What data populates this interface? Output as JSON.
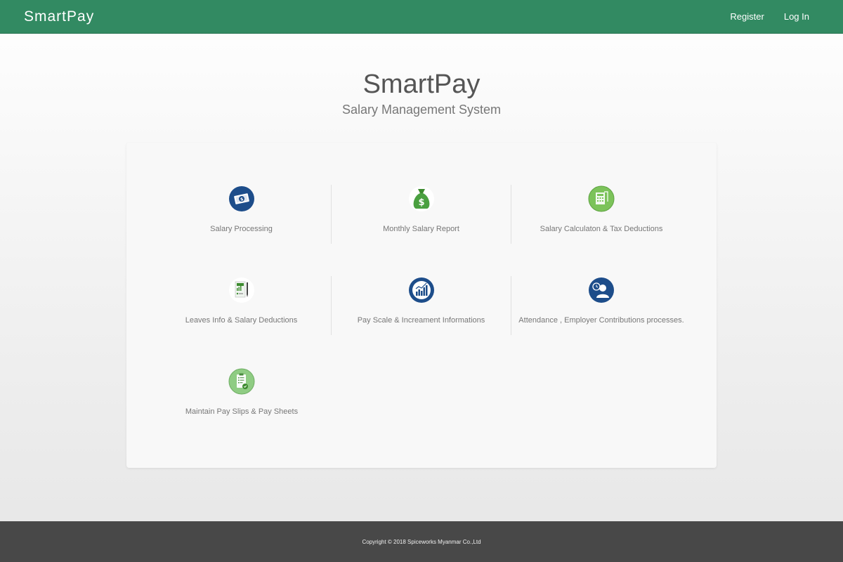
{
  "nav": {
    "brand": "SmartPay",
    "register_label": "Register",
    "login_label": "Log In"
  },
  "hero": {
    "title": "SmartPay",
    "subtitle": "Salary Management System"
  },
  "features": [
    {
      "label": "Salary Processing",
      "icon": "salary-processing-icon"
    },
    {
      "label": "Monthly Salary Report",
      "icon": "money-bag-icon"
    },
    {
      "label": "Salary Calculaton & Tax Deductions",
      "icon": "calculator-document-icon"
    },
    {
      "label": "Leaves Info & Salary Deductions",
      "icon": "leave-document-icon"
    },
    {
      "label": "Pay Scale & Increament Informations",
      "icon": "bar-chart-icon"
    },
    {
      "label": "Attendance , Employer Contributions processes.",
      "icon": "attendance-clock-icon"
    },
    {
      "label": "Maintain Pay Slips & Pay Sheets",
      "icon": "clipboard-icon"
    }
  ],
  "footer": {
    "copyright": "Copyright © 2018 Spiceworks Myanmar Co.,Ltd"
  },
  "colors": {
    "navbar": "#328a62",
    "footer": "#484848",
    "icon_blue": "#1d4d8a",
    "icon_green": "#4aa040"
  }
}
